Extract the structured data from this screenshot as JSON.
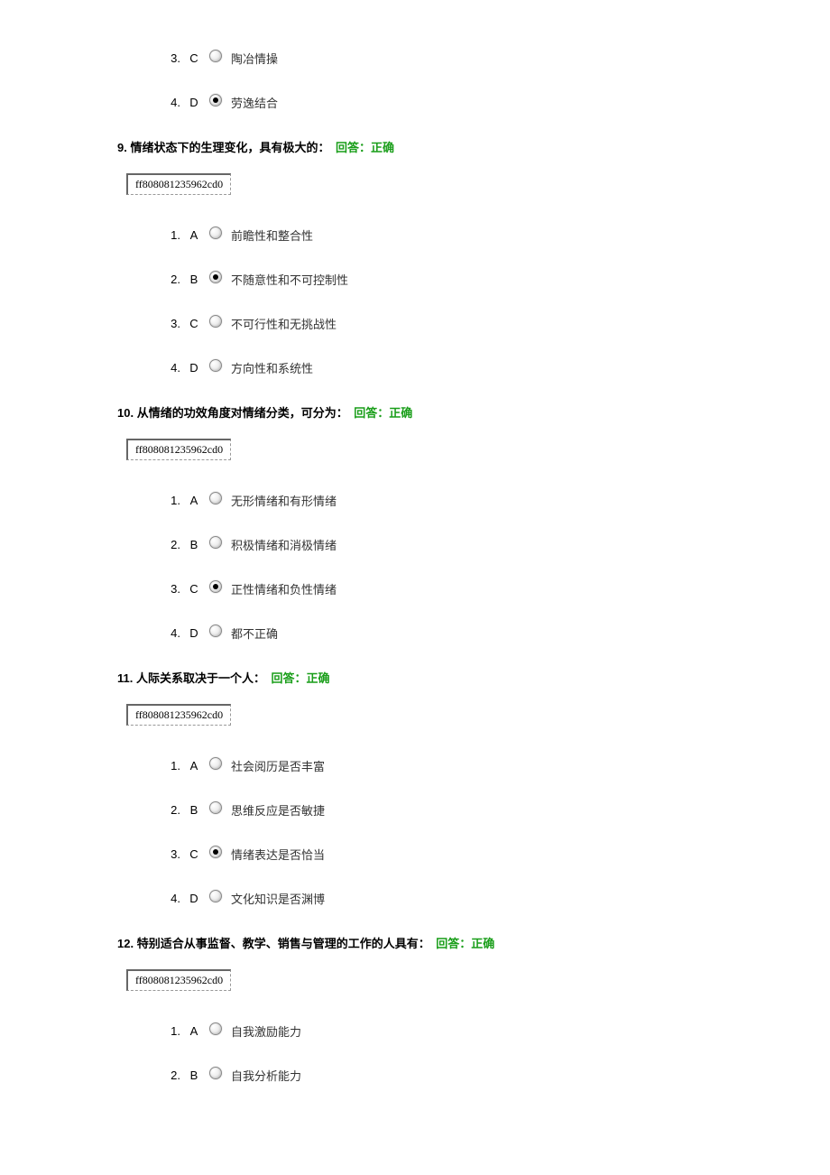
{
  "partial_question": {
    "options": [
      {
        "num": "3.",
        "letter": "C",
        "selected": false,
        "text": "陶冶情操"
      },
      {
        "num": "4.",
        "letter": "D",
        "selected": true,
        "text": "劳逸结合"
      }
    ]
  },
  "questions": [
    {
      "number": "9.",
      "text": "情绪状态下的生理变化，具有极大的：",
      "answer_label": "回答：",
      "answer_value": "正确",
      "id_code": "ff808081235962cd0",
      "options": [
        {
          "num": "1.",
          "letter": "A",
          "selected": false,
          "text": "前瞻性和整合性"
        },
        {
          "num": "2.",
          "letter": "B",
          "selected": true,
          "text": "不随意性和不可控制性"
        },
        {
          "num": "3.",
          "letter": "C",
          "selected": false,
          "text": "不可行性和无挑战性"
        },
        {
          "num": "4.",
          "letter": "D",
          "selected": false,
          "text": "方向性和系统性"
        }
      ]
    },
    {
      "number": "10.",
      "text": "从情绪的功效角度对情绪分类，可分为：",
      "answer_label": "回答：",
      "answer_value": "正确",
      "id_code": "ff808081235962cd0",
      "options": [
        {
          "num": "1.",
          "letter": "A",
          "selected": false,
          "text": "无形情绪和有形情绪"
        },
        {
          "num": "2.",
          "letter": "B",
          "selected": false,
          "text": "积极情绪和消极情绪"
        },
        {
          "num": "3.",
          "letter": "C",
          "selected": true,
          "text": "正性情绪和负性情绪"
        },
        {
          "num": "4.",
          "letter": "D",
          "selected": false,
          "text": "都不正确"
        }
      ]
    },
    {
      "number": "11.",
      "text": "人际关系取决于一个人：",
      "answer_label": "回答：",
      "answer_value": "正确",
      "id_code": "ff808081235962cd0",
      "options": [
        {
          "num": "1.",
          "letter": "A",
          "selected": false,
          "text": "社会阅历是否丰富"
        },
        {
          "num": "2.",
          "letter": "B",
          "selected": false,
          "text": "思维反应是否敏捷"
        },
        {
          "num": "3.",
          "letter": "C",
          "selected": true,
          "text": "情绪表达是否恰当"
        },
        {
          "num": "4.",
          "letter": "D",
          "selected": false,
          "text": "文化知识是否渊博"
        }
      ]
    },
    {
      "number": "12.",
      "text": "特别适合从事监督、教学、销售与管理的工作的人具有：",
      "answer_label": "回答：",
      "answer_value": "正确",
      "id_code": "ff808081235962cd0",
      "options": [
        {
          "num": "1.",
          "letter": "A",
          "selected": false,
          "text": "自我激励能力"
        },
        {
          "num": "2.",
          "letter": "B",
          "selected": false,
          "text": "自我分析能力"
        }
      ]
    }
  ]
}
